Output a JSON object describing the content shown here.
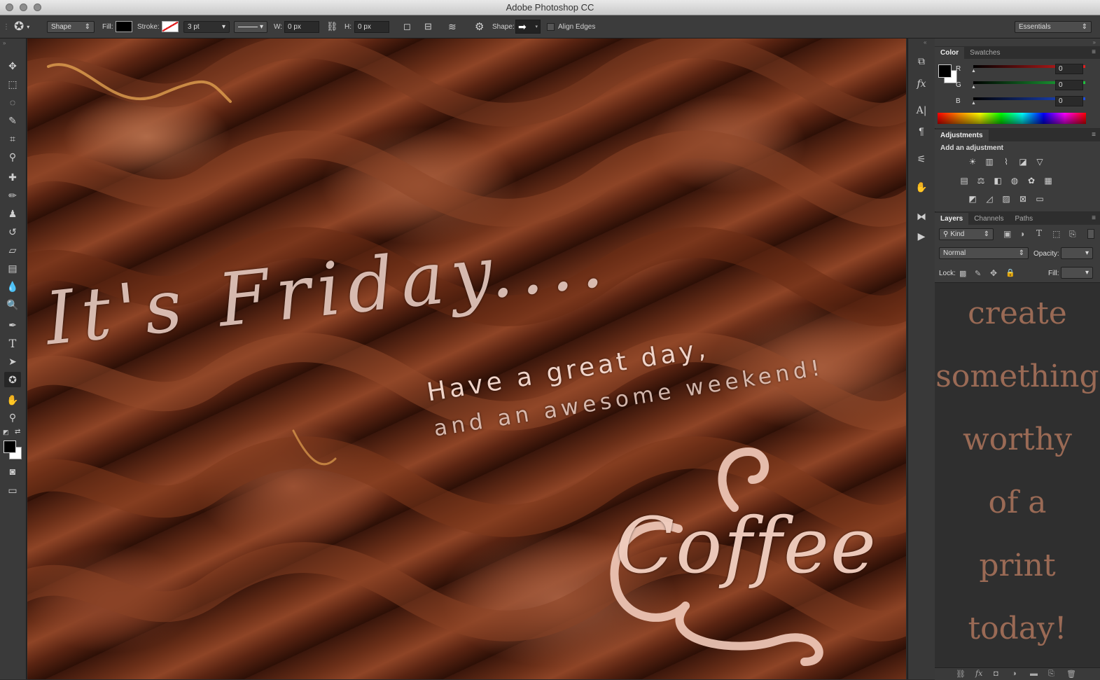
{
  "window": {
    "title": "Adobe Photoshop CC"
  },
  "options_bar": {
    "tool_mode": "Shape",
    "fill_label": "Fill:",
    "stroke_label": "Stroke:",
    "stroke_width": "3 pt",
    "w_label": "W:",
    "w_value": "0 px",
    "h_label": "H:",
    "h_value": "0 px",
    "shape_label": "Shape:",
    "align_edges_label": "Align Edges",
    "workspace": "Essentials"
  },
  "color_panel": {
    "tabs": [
      "Color",
      "Swatches"
    ],
    "channels": [
      {
        "label": "R",
        "value": "0",
        "color": "#e02020"
      },
      {
        "label": "G",
        "value": "0",
        "color": "#20c040"
      },
      {
        "label": "B",
        "value": "0",
        "color": "#2050e0"
      }
    ]
  },
  "adjustments_panel": {
    "tab": "Adjustments",
    "heading": "Add an adjustment"
  },
  "layers_panel": {
    "tabs": [
      "Layers",
      "Channels",
      "Paths"
    ],
    "filter": "Kind",
    "blend_mode": "Normal",
    "opacity_label": "Opacity:",
    "lock_label": "Lock:",
    "fill_label": "Fill:",
    "promo_lines": [
      "create",
      "something",
      "worthy",
      "of a",
      "print",
      "today!"
    ]
  },
  "canvas": {
    "headline": "It's Friday....",
    "line1": "Have a great day,",
    "line2": "and an awesome weekend!",
    "logo_word": "Coffee"
  }
}
